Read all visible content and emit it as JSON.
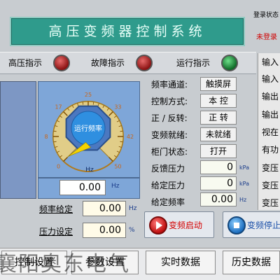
{
  "header": {
    "title": "高压变频器控制系统",
    "login_status": "登录状态",
    "login_user": "未登录"
  },
  "indicators": [
    {
      "label": "高压指示",
      "state": "red"
    },
    {
      "label": "故障指示",
      "state": "red"
    },
    {
      "label": "运行指示",
      "state": "green"
    }
  ],
  "gauge": {
    "center_label": "运行频率",
    "unit": "Hz",
    "ticks": [
      "0",
      "8",
      "17",
      "25",
      "33",
      "42",
      "50"
    ],
    "value": 0.0,
    "min": 0,
    "max": 50,
    "readout": "0.00",
    "readout_unit": "Hz"
  },
  "setpoints": [
    {
      "label": "频率给定",
      "value": "0.00",
      "unit": "Hz"
    },
    {
      "label": "压力设定",
      "value": "0.00",
      "unit": "%"
    }
  ],
  "params": [
    {
      "label": "频率通道:",
      "value": "触摸屏",
      "kind": "button"
    },
    {
      "label": "控制方式:",
      "value": "本 控",
      "kind": "button"
    },
    {
      "label": "正 / 反转:",
      "value": "正 转",
      "kind": "button"
    },
    {
      "label": "变频就绪:",
      "value": "未就绪",
      "kind": "button"
    },
    {
      "label": "柜门状态:",
      "value": "打开",
      "kind": "button"
    },
    {
      "label": "反馈压力",
      "value": "0",
      "unit": "kPa",
      "kind": "value"
    },
    {
      "label": "给定压力",
      "value": "0",
      "unit": "kPa",
      "kind": "value"
    },
    {
      "label": "给定频率",
      "value": "0.00",
      "unit": "Hz",
      "kind": "value"
    }
  ],
  "right_column": [
    "输入",
    "输入",
    "输出",
    "输出",
    "视在",
    "有功",
    "变压",
    "变压",
    "变压"
  ],
  "actions": {
    "start_label": "变频启动",
    "stop_label": "变频停止"
  },
  "nav": [
    {
      "label": "控制设置"
    },
    {
      "label": "参数设置"
    },
    {
      "label": "实时数据"
    },
    {
      "label": "历史数据"
    }
  ],
  "watermark": "襄阳奥东电气",
  "colors": {
    "title_bg": "#2f9b8c",
    "gauge_bg": "#7ea6d8",
    "lamp_red": "#b01a1a",
    "lamp_green": "#1a8a3a",
    "needle": "#f4d400"
  }
}
